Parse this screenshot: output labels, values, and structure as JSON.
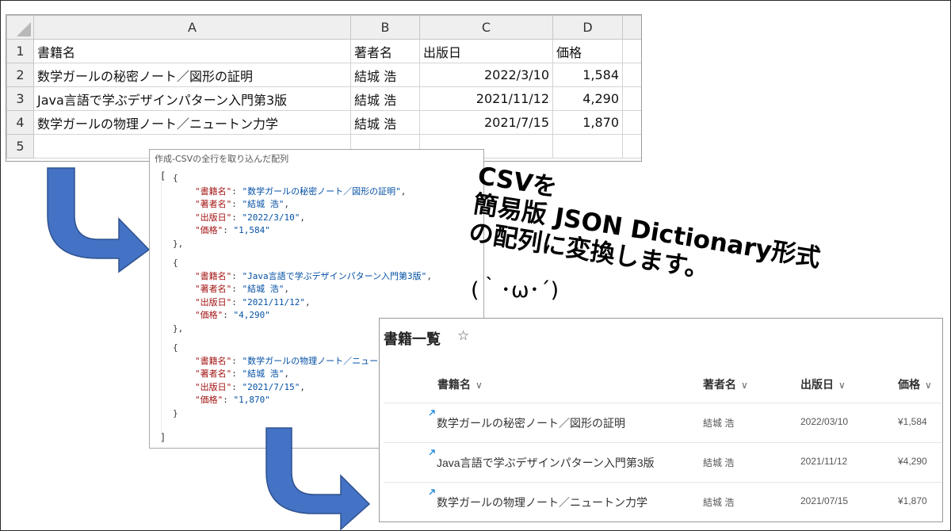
{
  "excel": {
    "columns": [
      "A",
      "B",
      "C",
      "D"
    ],
    "rows": [
      {
        "num": "1",
        "cells": [
          "書籍名",
          "著者名",
          "出版日",
          "価格"
        ]
      },
      {
        "num": "2",
        "cells": [
          "数学ガールの秘密ノート／図形の証明",
          "結城 浩",
          "2022/3/10",
          "1,584"
        ]
      },
      {
        "num": "3",
        "cells": [
          "Java言語で学ぶデザインパターン入門第3版",
          "結城 浩",
          "2021/11/12",
          "4,290"
        ]
      },
      {
        "num": "4",
        "cells": [
          "数学ガールの物理ノート／ニュートン力学",
          "結城 浩",
          "2021/7/15",
          "1,870"
        ]
      },
      {
        "num": "5",
        "cells": [
          "",
          "",
          "",
          ""
        ]
      }
    ]
  },
  "json_panel": {
    "title": "作成-CSVの全行を取り込んだ配列",
    "open_bracket": "[",
    "close_bracket": "]",
    "lines": [
      {
        "t": "p",
        "indent": 1,
        "text": "{"
      },
      {
        "t": "kv",
        "indent": 2,
        "key": "\"書籍名\"",
        "val": "\"数学ガールの秘密ノート／図形の証明\"",
        "end": ","
      },
      {
        "t": "kv",
        "indent": 2,
        "key": "\"著者名\"",
        "val": "\"結城 浩\"",
        "end": ","
      },
      {
        "t": "kv",
        "indent": 2,
        "key": "\"出版日\"",
        "val": "\"2022/3/10\"",
        "end": ","
      },
      {
        "t": "kv",
        "indent": 2,
        "key": "\"価格\"",
        "val": "\"1,584\"",
        "end": ""
      },
      {
        "t": "p",
        "indent": 1,
        "text": "},"
      },
      {
        "t": "p",
        "indent": 1,
        "text": "{"
      },
      {
        "t": "kv",
        "indent": 2,
        "key": "\"書籍名\"",
        "val": "\"Java言語で学ぶデザインパターン入門第3版\"",
        "end": ","
      },
      {
        "t": "kv",
        "indent": 2,
        "key": "\"著者名\"",
        "val": "\"結城 浩\"",
        "end": ","
      },
      {
        "t": "kv",
        "indent": 2,
        "key": "\"出版日\"",
        "val": "\"2021/11/12\"",
        "end": ","
      },
      {
        "t": "kv",
        "indent": 2,
        "key": "\"価格\"",
        "val": "\"4,290\"",
        "end": ""
      },
      {
        "t": "p",
        "indent": 1,
        "text": "},"
      },
      {
        "t": "p",
        "indent": 1,
        "text": "{"
      },
      {
        "t": "kv",
        "indent": 2,
        "key": "\"書籍名\"",
        "val": "\"数学ガールの物理ノート／ニュートン力学\"",
        "end": ","
      },
      {
        "t": "kv",
        "indent": 2,
        "key": "\"著者名\"",
        "val": "\"結城 浩\"",
        "end": ","
      },
      {
        "t": "kv",
        "indent": 2,
        "key": "\"出版日\"",
        "val": "\"2021/7/15\"",
        "end": ","
      },
      {
        "t": "kv",
        "indent": 2,
        "key": "\"価格\"",
        "val": "\"1,870\"",
        "end": ""
      },
      {
        "t": "p",
        "indent": 1,
        "text": "}"
      }
    ]
  },
  "caption": {
    "line1": "CSVを",
    "line2": "簡易版 JSON Dictionary形式",
    "line3": "の配列に変換します。",
    "kaomoji": "(｀･ω･´)"
  },
  "sharepoint": {
    "title": "書籍一覧",
    "star_icon": "star-outline-icon",
    "columns": [
      "書籍名",
      "著者名",
      "出版日",
      "価格"
    ],
    "chevron": "∨",
    "rows": [
      {
        "title": "数学ガールの秘密ノート／図形の証明",
        "author": "結城 浩",
        "date": "2022/03/10",
        "price": "¥1,584"
      },
      {
        "title": "Java言語で学ぶデザインパターン入門第3版",
        "author": "結城 浩",
        "date": "2021/11/12",
        "price": "¥4,290"
      },
      {
        "title": "数学ガールの物理ノート／ニュートン力学",
        "author": "結城 浩",
        "date": "2021/07/15",
        "price": "¥1,870"
      }
    ]
  },
  "colors": {
    "arrow": "#4472c4",
    "arrow_stroke": "#2f528f",
    "json_key": "#a31515",
    "json_value": "#0451a5",
    "new_item_mark": "#0078d4"
  }
}
